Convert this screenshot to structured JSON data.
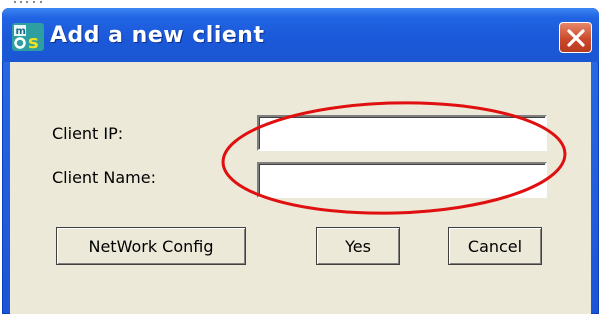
{
  "window": {
    "title": "Add a new client",
    "icon": "app-logo-icon",
    "close_icon": "close-icon"
  },
  "form": {
    "client_ip_label": "Client IP:",
    "client_ip_value": "",
    "client_name_label": "Client Name:",
    "client_name_value": ""
  },
  "buttons": {
    "network_config": "NetWork Config",
    "yes": "Yes",
    "cancel": "Cancel"
  },
  "colors": {
    "title_bar": "#1b57d3",
    "dialog_face": "#ece9d8",
    "close_button": "#cc4a2c",
    "annotation_ellipse": "#e01010"
  }
}
